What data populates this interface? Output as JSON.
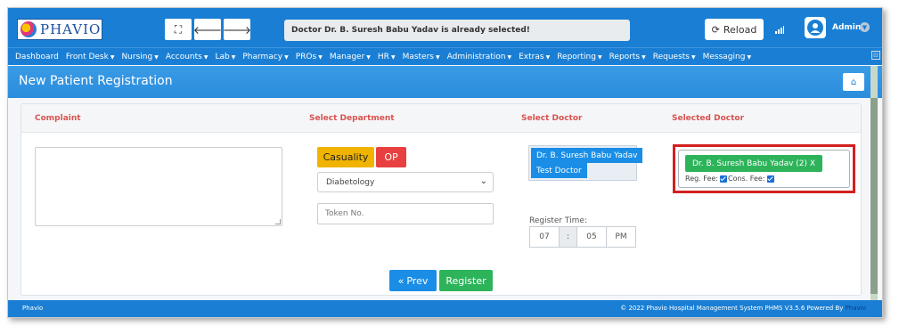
{
  "header": {
    "logo_text": "PHAVIO",
    "message": "Doctor Dr. B. Suresh Babu Yadav is already selected!",
    "reload_label": "Reload",
    "user_name": "Admin"
  },
  "menu": [
    {
      "label": "Dashboard",
      "dropdown": false
    },
    {
      "label": "Front Desk",
      "dropdown": true
    },
    {
      "label": "Nursing",
      "dropdown": true
    },
    {
      "label": "Accounts",
      "dropdown": true
    },
    {
      "label": "Lab",
      "dropdown": true
    },
    {
      "label": "Pharmacy",
      "dropdown": true
    },
    {
      "label": "PROs",
      "dropdown": true
    },
    {
      "label": "Manager",
      "dropdown": true
    },
    {
      "label": "HR",
      "dropdown": true
    },
    {
      "label": "Masters",
      "dropdown": true
    },
    {
      "label": "Administration",
      "dropdown": true
    },
    {
      "label": "Extras",
      "dropdown": true
    },
    {
      "label": "Reporting",
      "dropdown": true
    },
    {
      "label": "Reports",
      "dropdown": true
    },
    {
      "label": "Requests",
      "dropdown": true
    },
    {
      "label": "Messaging",
      "dropdown": true
    }
  ],
  "page": {
    "title": "New Patient Registration"
  },
  "form": {
    "headers": {
      "complaint": "Complaint",
      "department": "Select Department",
      "doctor": "Select Doctor",
      "selected": "Selected Doctor"
    },
    "complaint_value": "",
    "casualty_label": "Casuality",
    "op_label": "OP",
    "department_value": "Diabetology",
    "token_placeholder": "Token No.",
    "doctor_options": [
      "Dr. B. Suresh Babu Yadav",
      "Test Doctor"
    ],
    "register_time_label": "Register Time:",
    "time": {
      "hour": "07",
      "sep": ":",
      "minute": "05",
      "ampm": "PM"
    },
    "selected_doctor": "Dr. B. Suresh Babu Yadav (2) X",
    "reg_fee_label": "Reg. Fee:",
    "reg_fee_checked": true,
    "cons_fee_label": "Cons. Fee:",
    "cons_fee_checked": true,
    "prev_label": "Prev",
    "register_label": "Register"
  },
  "footer": {
    "left": "Phavio",
    "right": "© 2022 Phavio Hospital Management System PHMS V3.5.6 Powered By",
    "brand": "Phavio"
  },
  "colors": {
    "primary": "#1a7fd4",
    "success": "#2db45a",
    "warning": "#f0b400",
    "danger": "#e84040",
    "highlight": "#d42020"
  }
}
